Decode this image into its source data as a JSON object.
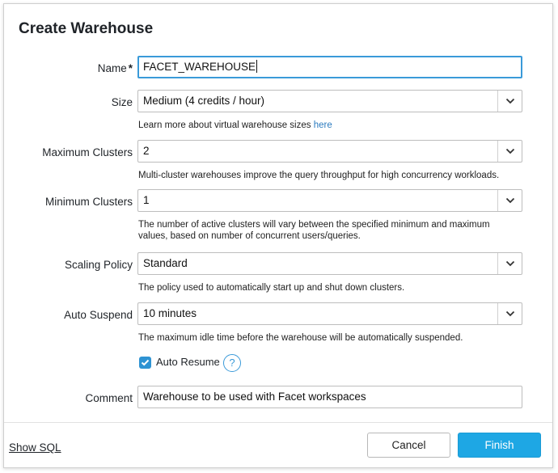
{
  "dialog": {
    "title": "Create Warehouse"
  },
  "fields": {
    "name": {
      "label": "Name",
      "required_mark": "*",
      "value": "FACET_WAREHOUSE"
    },
    "size": {
      "label": "Size",
      "value": "Medium  (4 credits / hour)",
      "help": "Learn more about virtual warehouse sizes ",
      "help_link": "here"
    },
    "max_clusters": {
      "label": "Maximum Clusters",
      "value": "2",
      "help": "Multi-cluster warehouses improve the query throughput for high concurrency workloads."
    },
    "min_clusters": {
      "label": "Minimum Clusters",
      "value": "1",
      "help_line1": "The number of active clusters will vary between the specified minimum and maximum",
      "help_line2": "values, based on number of concurrent users/queries."
    },
    "scaling_policy": {
      "label": "Scaling Policy",
      "value": "Standard",
      "help": "The policy used to automatically start up and shut down clusters."
    },
    "auto_suspend": {
      "label": "Auto Suspend",
      "value": "10 minutes",
      "help": "The maximum idle time before the warehouse will be automatically suspended."
    },
    "auto_resume": {
      "label": "Auto Resume",
      "checked": true,
      "help_icon": "?"
    },
    "comment": {
      "label": "Comment",
      "value": "Warehouse to be used with Facet workspaces"
    }
  },
  "footer": {
    "show_sql": "Show SQL",
    "cancel": "Cancel",
    "finish": "Finish"
  },
  "colors": {
    "accent": "#1ea7e4",
    "link": "#2b7bbf",
    "focus_border": "#3a9ad9"
  },
  "icons": {
    "dropdown": "chevron-down-icon",
    "checkbox": "check-icon",
    "help": "question-circle-icon"
  }
}
